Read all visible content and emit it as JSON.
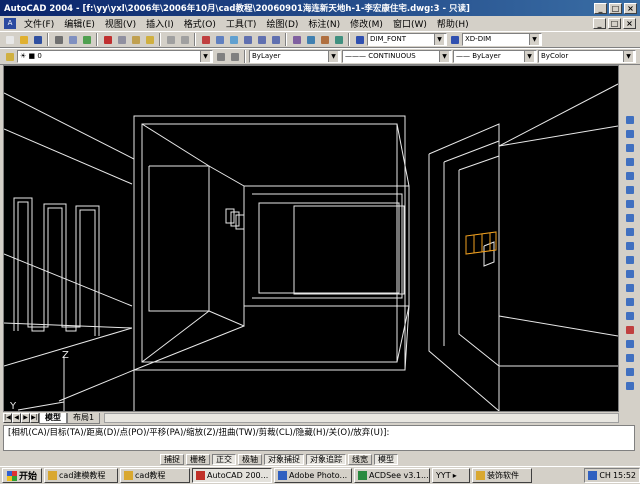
{
  "window": {
    "title": "AutoCAD 2004 - [f:\\yy\\yxl\\2006年\\2006年10月\\cad教程\\20060901海连新天地h-1-李宏康住宅.dwg:3 - 只读]",
    "buttons": [
      "_",
      "□",
      "×"
    ]
  },
  "menu": {
    "items": [
      "文件(F)",
      "编辑(E)",
      "视图(V)",
      "插入(I)",
      "格式(O)",
      "工具(T)",
      "绘图(D)",
      "标注(N)",
      "修改(M)",
      "窗口(W)",
      "帮助(H)"
    ],
    "doc_buttons": [
      "_",
      "□",
      "×"
    ]
  },
  "toolbar": {
    "text_style": "DIM_FONT",
    "dim_style": "XD-DIM",
    "layer_value": "0",
    "color": "ByLayer",
    "linetype": "CONTINUOUS",
    "lineweight": "ByLayer",
    "plotstyle": "ByColor"
  },
  "drawing": {
    "ucs_labels": {
      "z": "Z",
      "y": "Y"
    }
  },
  "layout_tabs": {
    "nav": [
      "|◀",
      "◀",
      "▶",
      "▶|"
    ],
    "tabs": [
      "模型",
      "布局1"
    ]
  },
  "command": {
    "line": "[相机(CA)/目标(TA)/距离(D)/点(PO)/平移(PA)/缩放(Z)/扭曲(TW)/剪裁(CL)/隐藏(H)/关(O)/放弃(U)]:"
  },
  "status": {
    "buttons": [
      {
        "label": "捕捉",
        "on": false
      },
      {
        "label": "栅格",
        "on": false
      },
      {
        "label": "正交",
        "on": true
      },
      {
        "label": "极轴",
        "on": false
      },
      {
        "label": "对象捕捉",
        "on": true
      },
      {
        "label": "对象追踪",
        "on": true
      },
      {
        "label": "线宽",
        "on": false
      },
      {
        "label": "模型",
        "on": true
      }
    ]
  },
  "taskbar": {
    "start": "开始",
    "tasks": [
      {
        "label": "cad建模教程",
        "active": false,
        "color": "#d9a830"
      },
      {
        "label": "cad教程",
        "active": false,
        "color": "#d9a830"
      },
      {
        "label": "AutoCAD 200...",
        "active": true,
        "color": "#c03028"
      },
      {
        "label": "Adobe Photo...",
        "active": false,
        "color": "#3060c0"
      },
      {
        "label": "ACDSee v3.1...",
        "active": false,
        "color": "#2a8a40"
      },
      {
        "label": "YYT",
        "active": false,
        "color": "#909090"
      },
      {
        "label": "装饰软件",
        "active": false,
        "color": "#d9a830"
      }
    ],
    "tray_lang": "CH",
    "clock": "15:52"
  }
}
